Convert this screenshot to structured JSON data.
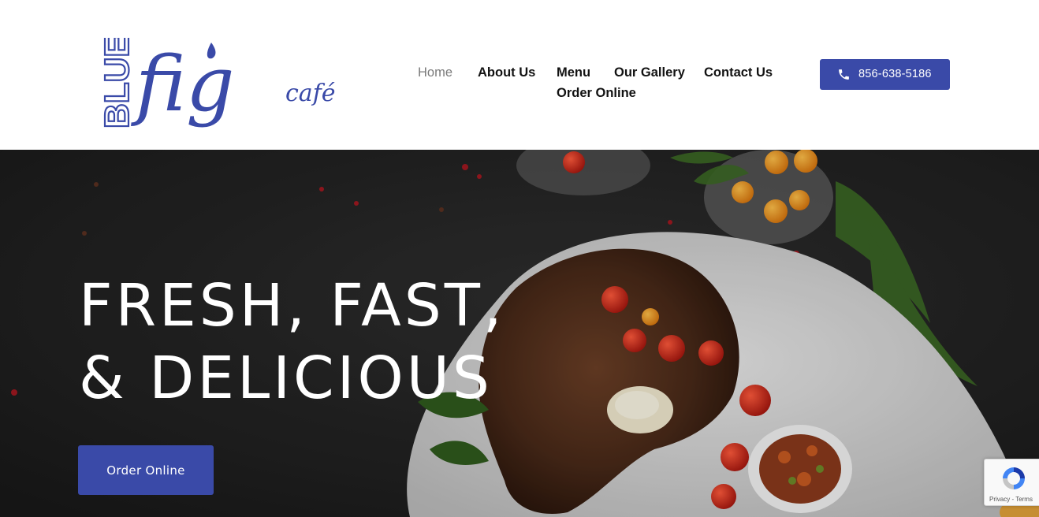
{
  "brand": {
    "logo_word_blue": "BLUE",
    "logo_word_fig": "fig",
    "logo_word_cafe": "café",
    "color": "#3a4aa8"
  },
  "nav": {
    "items": [
      {
        "label": "Home",
        "active": true
      },
      {
        "label": "About Us"
      },
      {
        "label": "Menu"
      },
      {
        "label": "Our Gallery"
      },
      {
        "label": "Contact Us"
      },
      {
        "label": "Order Online"
      }
    ]
  },
  "phone": {
    "icon": "phone-icon",
    "number": "856-638-5186"
  },
  "hero": {
    "headline_line1": "FRESH, FAST,",
    "headline_line2": "& DELICIOUS",
    "cta_label": "Order Online"
  },
  "recaptcha": {
    "footer": "Privacy - Terms"
  },
  "colors": {
    "accent": "#3a4aa8",
    "nav_text": "#121212",
    "nav_active": "#7b7b7b",
    "hero_bg": "#1e1e1e"
  }
}
